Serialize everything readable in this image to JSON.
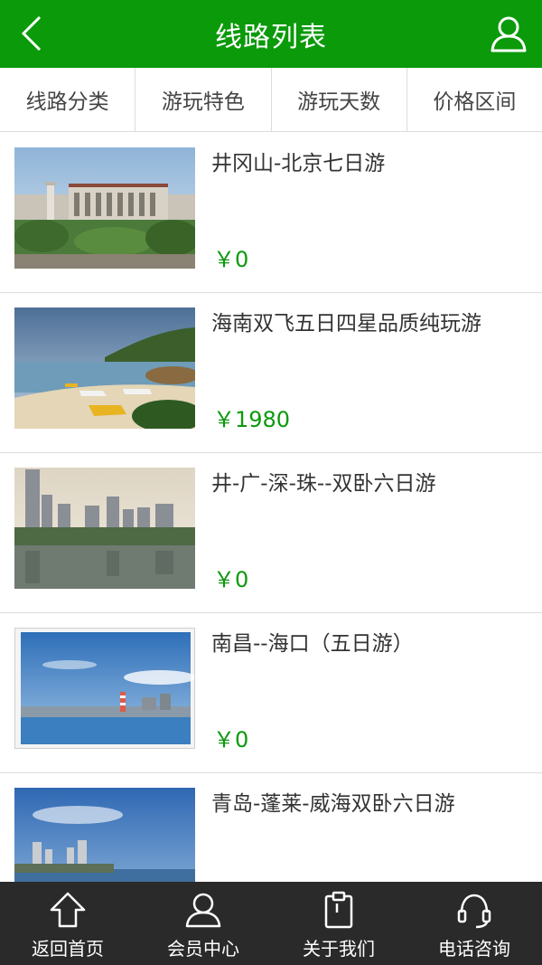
{
  "header": {
    "title": "线路列表",
    "back_icon": "chevron-left-icon",
    "user_icon": "user-icon"
  },
  "filters": [
    {
      "label": "线路分类"
    },
    {
      "label": "游玩特色"
    },
    {
      "label": "游玩天数"
    },
    {
      "label": "价格区间"
    }
  ],
  "routes": [
    {
      "title": "井冈山-北京七日游",
      "price": "￥0",
      "image": "beijing-building"
    },
    {
      "title": "海南双飞五日四星品质纯玩游",
      "price": "￥1980",
      "image": "hainan-beach"
    },
    {
      "title": "井-广-深-珠--双卧六日游",
      "price": "￥0",
      "image": "city-skyline-lake"
    },
    {
      "title": "南昌--海口（五日游）",
      "price": "￥0",
      "image": "lighthouse-sea"
    },
    {
      "title": "青岛-蓬莱-威海双卧六日游",
      "price": "",
      "image": "qingdao-coast"
    }
  ],
  "tabbar": [
    {
      "label": "返回首页",
      "icon": "home-icon"
    },
    {
      "label": "会员中心",
      "icon": "user-icon"
    },
    {
      "label": "关于我们",
      "icon": "clipboard-icon"
    },
    {
      "label": "电话咨询",
      "icon": "headset-icon"
    }
  ],
  "colors": {
    "primary": "#0a9a0a",
    "tabbar": "#2a2a2a",
    "divider": "#dcdcdc"
  }
}
